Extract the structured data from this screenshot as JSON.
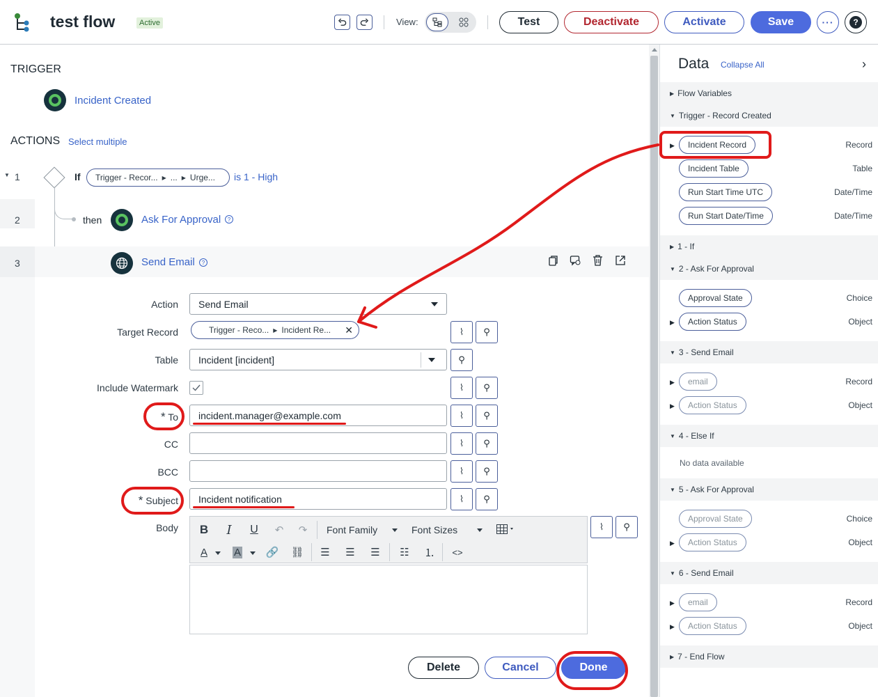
{
  "header": {
    "title": "test flow",
    "status": "Active",
    "view_label": "View:",
    "buttons": {
      "test": "Test",
      "deactivate": "Deactivate",
      "activate": "Activate",
      "save": "Save"
    }
  },
  "trigger": {
    "heading": "TRIGGER",
    "name": "Incident Created"
  },
  "actions": {
    "heading": "ACTIONS",
    "select_multiple": "Select multiple",
    "steps": [
      {
        "num": "1",
        "keyword": "If",
        "pill_part1": "Trigger - Recor...",
        "pill_part2": "...",
        "pill_part3": "Urge...",
        "condition": "is 1 - High"
      },
      {
        "num": "2",
        "keyword": "then",
        "name": "Ask For Approval"
      },
      {
        "num": "3",
        "name": "Send Email"
      }
    ]
  },
  "form": {
    "labels": {
      "action": "Action",
      "target": "Target Record",
      "table": "Table",
      "watermark": "Include Watermark",
      "to": "To",
      "cc": "CC",
      "bcc": "BCC",
      "subject": "Subject",
      "body": "Body"
    },
    "required_mark": "*",
    "action_value": "Send Email",
    "target_part1": "Trigger - Reco...",
    "target_part2": "Incident Re...",
    "table_value": "Incident [incident]",
    "to_value": "incident.manager@example.com",
    "cc_value": "",
    "bcc_value": "",
    "subject_value": "Incident notification",
    "toolbar": {
      "font_family": "Font Family",
      "font_sizes": "Font Sizes"
    },
    "buttons": {
      "delete": "Delete",
      "cancel": "Cancel",
      "done": "Done"
    }
  },
  "data_panel": {
    "title": "Data",
    "collapse_all": "Collapse All",
    "sections": {
      "flow_variables": "Flow Variables",
      "trigger": "Trigger - Record Created",
      "s1": "1 - If",
      "s2": "2 - Ask For Approval",
      "s3": "3 - Send Email",
      "s4": "4 - Else If",
      "s5": "5 - Ask For Approval",
      "s6": "6 - Send Email",
      "s7": "7 - End Flow"
    },
    "trigger_items": [
      {
        "label": "Incident Record",
        "type": "Record"
      },
      {
        "label": "Incident Table",
        "type": "Table"
      },
      {
        "label": "Run Start Time UTC",
        "type": "Date/Time"
      },
      {
        "label": "Run Start Date/Time",
        "type": "Date/Time"
      }
    ],
    "s2_items": [
      {
        "label": "Approval State",
        "type": "Choice"
      },
      {
        "label": "Action Status",
        "type": "Object"
      }
    ],
    "s3_items": [
      {
        "label": "email",
        "type": "Record"
      },
      {
        "label": "Action Status",
        "type": "Object"
      }
    ],
    "s4_empty": "No data available",
    "s5_items": [
      {
        "label": "Approval State",
        "type": "Choice"
      },
      {
        "label": "Action Status",
        "type": "Object"
      }
    ],
    "s6_items": [
      {
        "label": "email",
        "type": "Record"
      },
      {
        "label": "Action Status",
        "type": "Object"
      }
    ]
  },
  "colors": {
    "primary": "#4d6bde",
    "danger": "#b2262f",
    "annotation": "#e01a1a",
    "link": "#3863c8"
  }
}
